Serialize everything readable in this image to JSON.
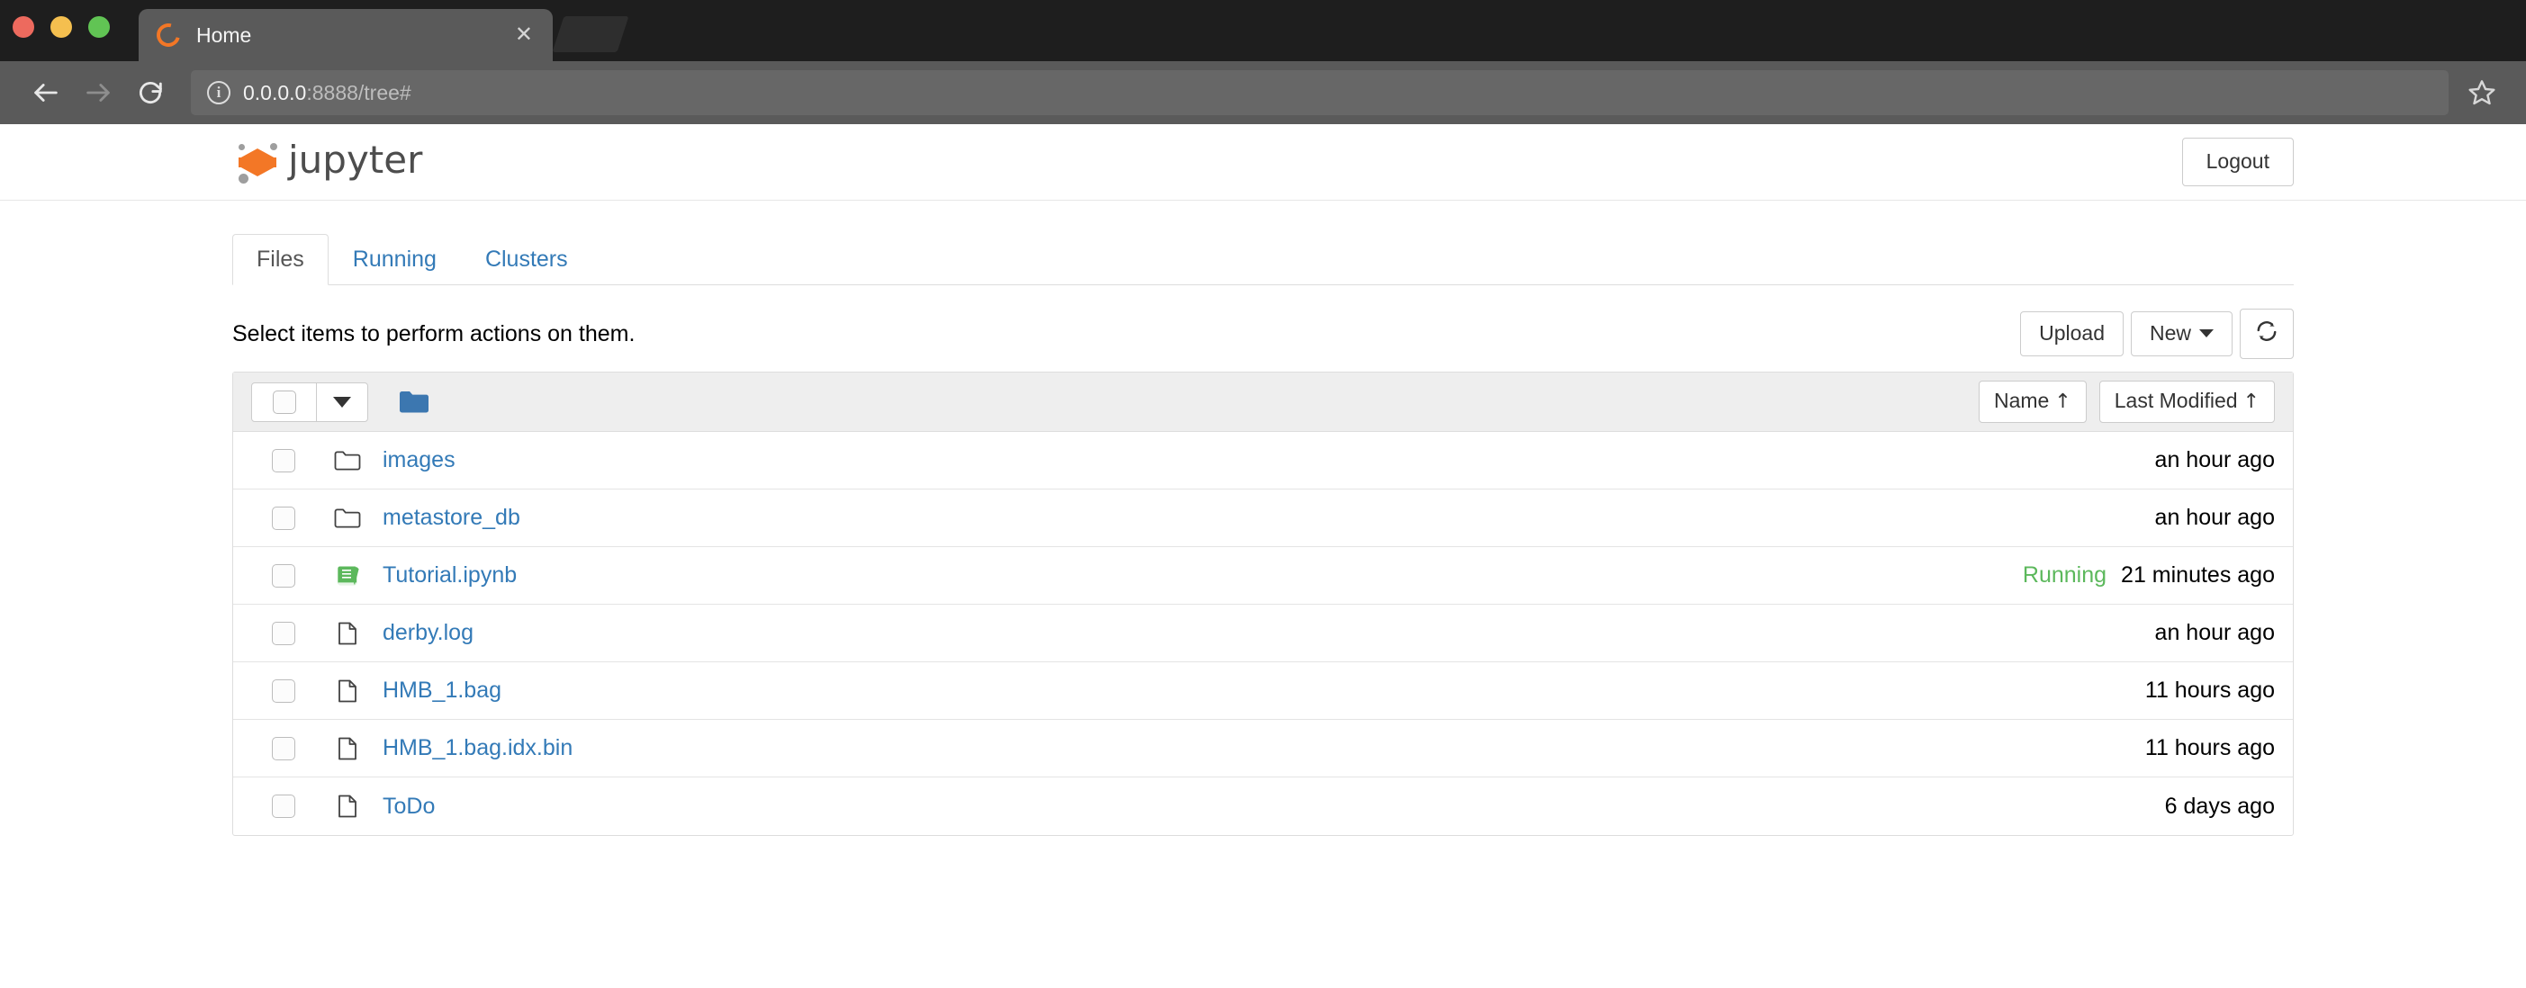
{
  "browser": {
    "tab": {
      "title": "Home",
      "favicon": "jupyter-favicon",
      "close_label": "✕"
    },
    "nav": {
      "back": "back-arrow",
      "forward": "forward-arrow",
      "reload": "reload-arrow"
    },
    "address": {
      "info_glyph": "i",
      "host": "0.0.0.0",
      "rest": ":8888/tree#"
    },
    "bookmark": "star-outline-icon"
  },
  "header": {
    "brand": "jupyter",
    "logout_label": "Logout"
  },
  "tabs": [
    {
      "label": "Files",
      "active": true
    },
    {
      "label": "Running",
      "active": false
    },
    {
      "label": "Clusters",
      "active": false
    }
  ],
  "toolbar": {
    "message": "Select items to perform actions on them.",
    "upload_label": "Upload",
    "new_label": "New",
    "refresh_label": "⟳"
  },
  "list_header": {
    "select_all_checkbox": "",
    "breadcrumb_folder": "folder-icon",
    "sort_name_label": "Name",
    "sort_name_arrow": "↑",
    "sort_modified_label": "Last Modified",
    "sort_modified_arrow": "↑"
  },
  "files": [
    {
      "name": "images",
      "icon": "folder",
      "status": "",
      "modified": "an hour ago"
    },
    {
      "name": "metastore_db",
      "icon": "folder",
      "status": "",
      "modified": "an hour ago"
    },
    {
      "name": "Tutorial.ipynb",
      "icon": "notebook",
      "status": "Running",
      "modified": "21 minutes ago"
    },
    {
      "name": "derby.log",
      "icon": "file",
      "status": "",
      "modified": "an hour ago"
    },
    {
      "name": "HMB_1.bag",
      "icon": "file",
      "status": "",
      "modified": "11 hours ago"
    },
    {
      "name": "HMB_1.bag.idx.bin",
      "icon": "file",
      "status": "",
      "modified": "11 hours ago"
    },
    {
      "name": "ToDo",
      "icon": "file",
      "status": "",
      "modified": "6 days ago"
    }
  ],
  "colors": {
    "jupyter_orange": "#f37726",
    "link_blue": "#337ab7",
    "running_green": "#5cb85c",
    "chrome_dark": "#1e1e1e",
    "chrome_toolbar": "#5a5a5a"
  }
}
